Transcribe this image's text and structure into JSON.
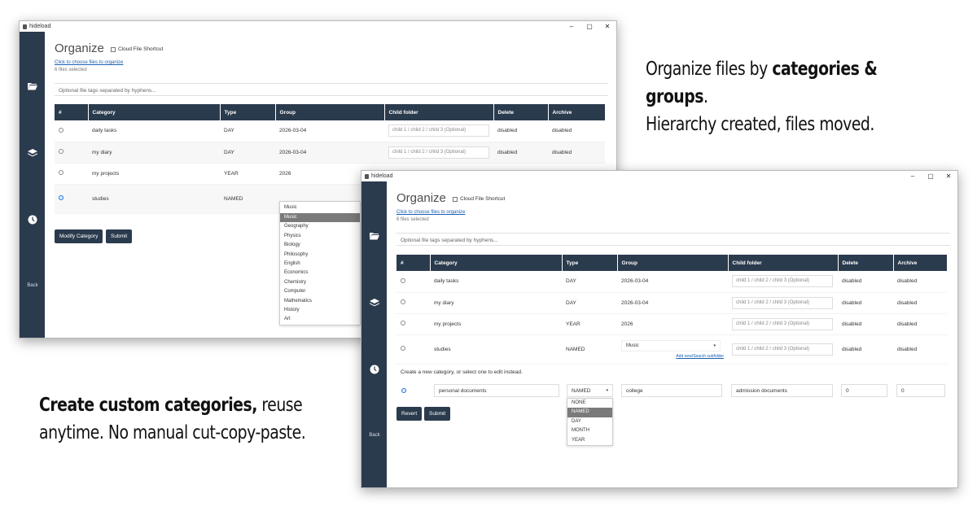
{
  "app": {
    "title": "hideload",
    "back_label": "Back"
  },
  "window_controls": {
    "minimize": "–",
    "maximize": "▢",
    "close": "✕"
  },
  "organize": {
    "title": "Organize",
    "shortcut_label": "Cloud File Shortcut",
    "choose_link": "Click to choose files to organize",
    "files_selected": "6 files selected",
    "tags_placeholder": "Optional file tags separated by hyphens..."
  },
  "table": {
    "headers": [
      "#",
      "Category",
      "Type",
      "Group",
      "Child folder",
      "Delete",
      "Archive"
    ],
    "child_placeholder": "child 1 / child 2 / child 3 (Optional)",
    "rows": [
      {
        "category": "daily tasks",
        "type": "DAY",
        "group": "2026-03-04",
        "delete": "disabled",
        "archive": "disabled"
      },
      {
        "category": "my diary",
        "type": "DAY",
        "group": "2026-03-04",
        "delete": "disabled",
        "archive": "disabled"
      },
      {
        "category": "my projects",
        "type": "YEAR",
        "group": "2026",
        "delete": "disabled",
        "archive": "disabled"
      },
      {
        "category": "studies",
        "type": "NAMED",
        "group": "Music",
        "delete": "disabled",
        "archive": "disabled"
      }
    ]
  },
  "back_window": {
    "dropdown_value": "Music",
    "dropdown_options": [
      "Music",
      "Geography",
      "Physics",
      "Biology",
      "Philosophy",
      "English",
      "Economics",
      "Chemistry",
      "Computer",
      "Mathematics",
      "History",
      "Art"
    ],
    "buttons": {
      "modify": "Modify Category",
      "submit": "Submit"
    }
  },
  "front_window": {
    "add_new_link": "Add new/Search subfolder",
    "create_hint": "Create a new category, or select one to edit instead.",
    "edit_row": {
      "category": "personal documents",
      "type": "NAMED",
      "group": "college",
      "child": "admission documents",
      "delete": "0",
      "archive": "0"
    },
    "type_options": [
      "NONE",
      "NAMED",
      "DAY",
      "MONTH",
      "YEAR"
    ],
    "type_selected": "NAMED",
    "buttons": {
      "revert": "Revert",
      "submit": "Submit"
    }
  },
  "marketing": {
    "top_line1_pre": "Organize files by ",
    "top_line1_bold": "categories & groups",
    "top_line1_post": ".",
    "top_line2": "Hierarchy created, files moved.",
    "bottom_bold": "Create custom categories,",
    "bottom_rest1": " reuse",
    "bottom_line2": "anytime. No manual cut-copy-paste."
  },
  "icons": {
    "folder": "folder-open-icon",
    "layers": "layers-icon",
    "clock": "clock-icon"
  },
  "colors": {
    "sidebar": "#2b3b4e",
    "header": "#2b3b4e",
    "link": "#1a5fb4",
    "accent_radio": "#1e73e8"
  }
}
